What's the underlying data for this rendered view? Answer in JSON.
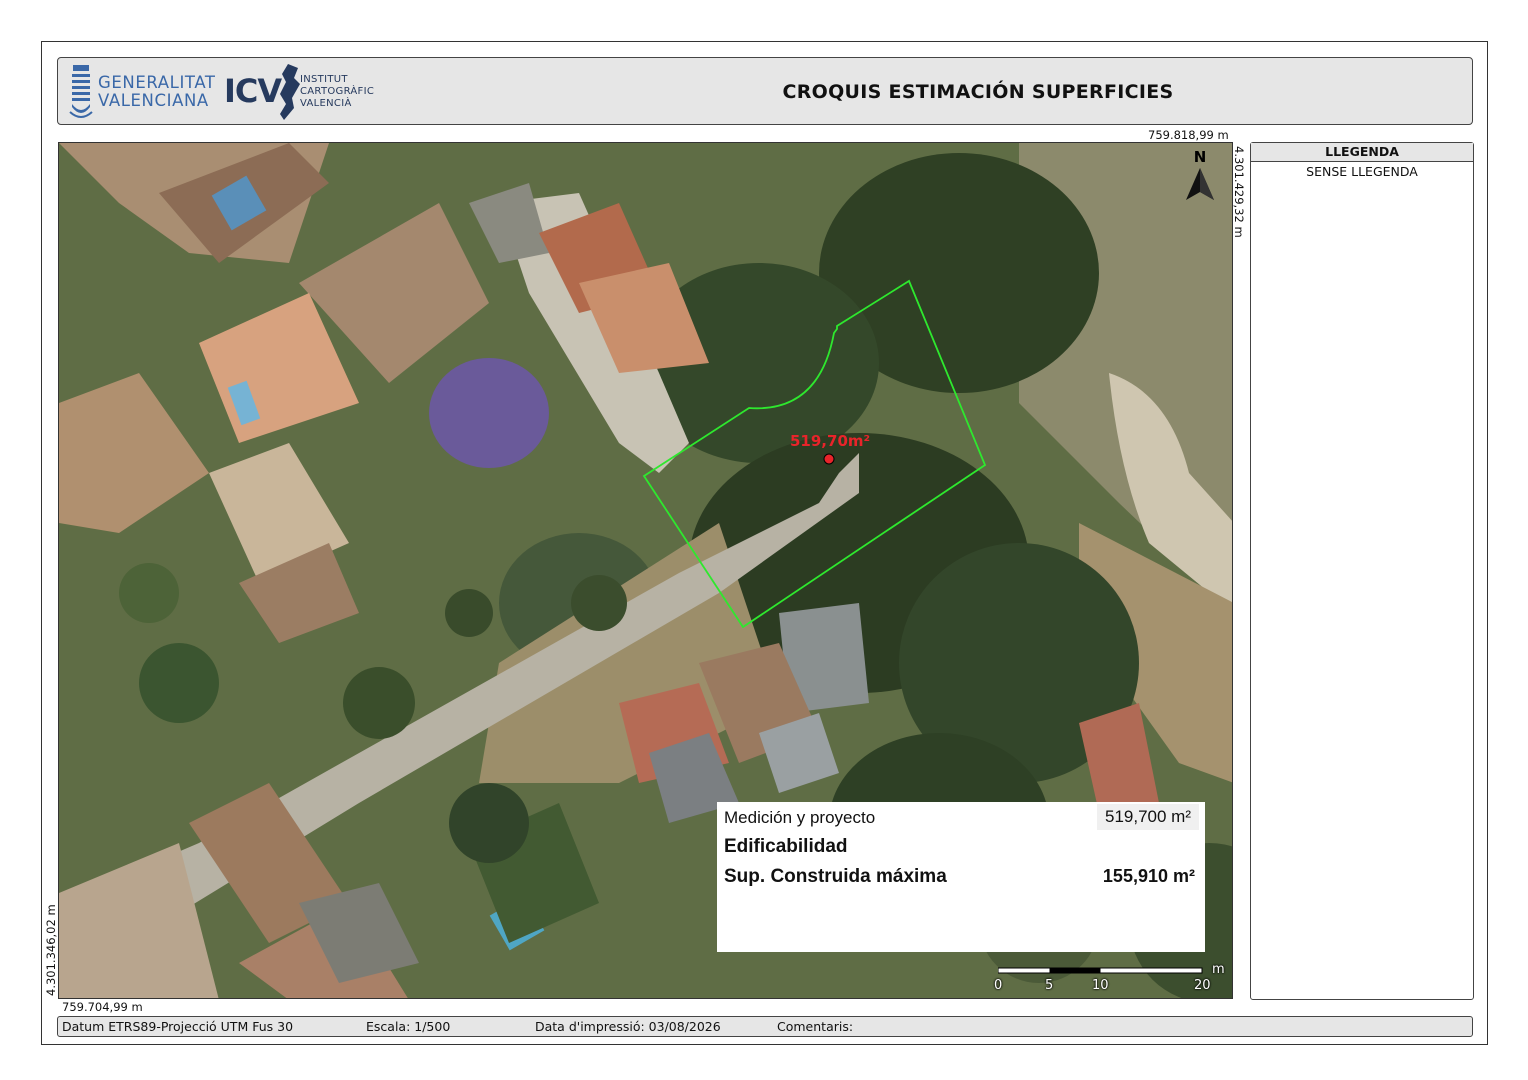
{
  "header": {
    "title": "CROQUIS ESTIMACIÓN SUPERFICIES",
    "logo_gv_line1": "GENERALITAT",
    "logo_gv_line2": "VALENCIANA",
    "logo_icv_abbr": "ICV",
    "logo_icv_line1": "INSTITUT",
    "logo_icv_line2": "CARTOGRÀFIC",
    "logo_icv_line3": "VALENCIÀ"
  },
  "coordinates": {
    "top_right_x": "759.818,99 m",
    "top_right_y": "4.301.429,32 m",
    "bottom_left_x": "759.704,99 m",
    "bottom_left_y": "4.301.346,02 m"
  },
  "map": {
    "parcel_area_label": "519,70m²",
    "parcel_outline_color": "#2ee82e",
    "centroid_color": "#e8242a",
    "north_label": "N",
    "scale_unit": "m",
    "scale_ticks": [
      "0",
      "5",
      "10",
      "20"
    ]
  },
  "infobox": {
    "row1_label": "Medición y proyecto",
    "row1_value": "519,700 m²",
    "row2_label": "Edificabilidad",
    "row3_label": "Sup. Construida máxima",
    "row3_value": "155,910 m²"
  },
  "legend": {
    "title": "LLEGENDA",
    "body": "SENSE LLEGENDA"
  },
  "footer": {
    "datum": "Datum ETRS89-Projecció UTM Fus 30",
    "scale": "Escala: 1/500",
    "print_date": "Data d'impressió: 03/08/2026",
    "comments": "Comentaris:"
  }
}
